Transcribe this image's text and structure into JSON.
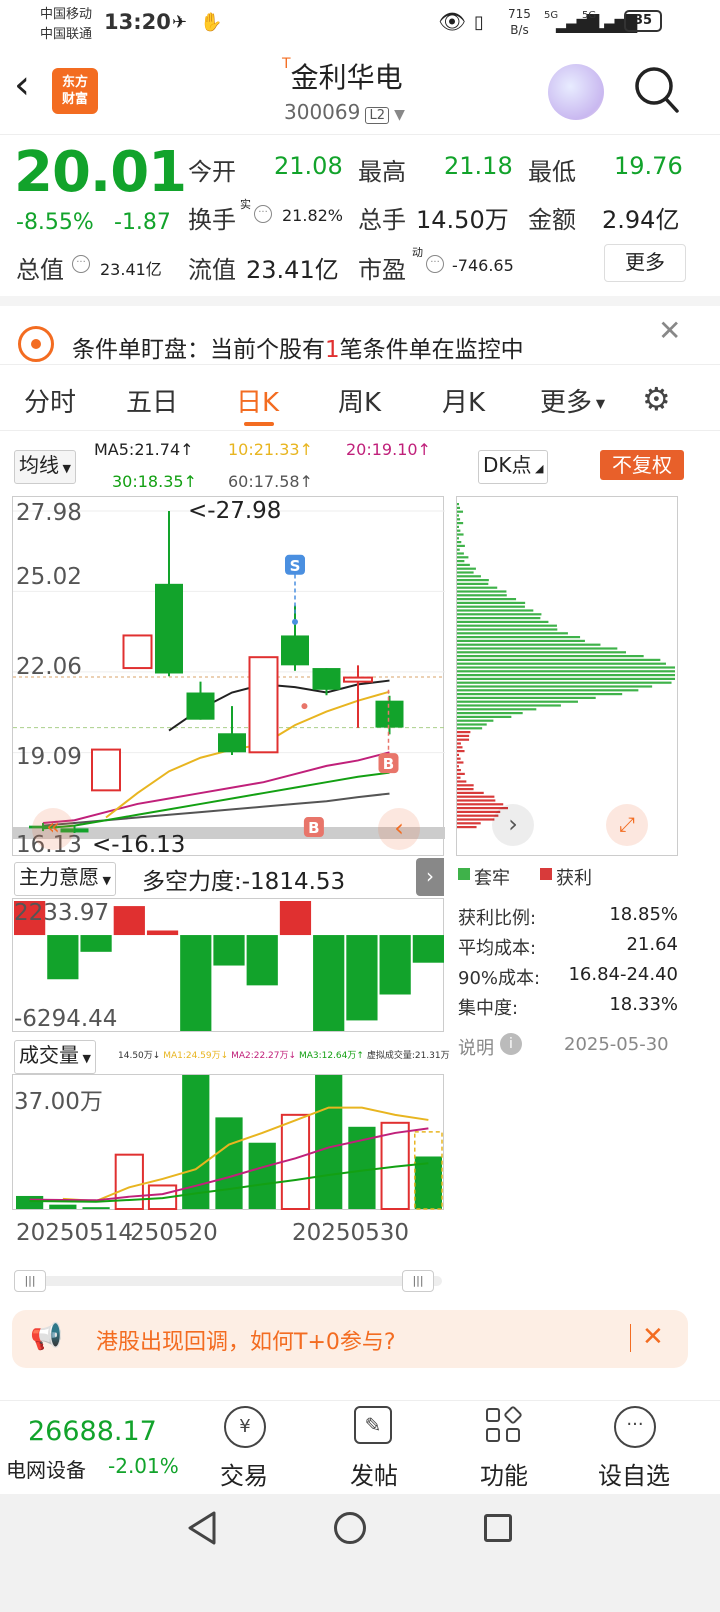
{
  "status_bar": {
    "carrier1": "中国移动",
    "carrier2": "中国联通",
    "time": "13:20",
    "speed_value": "715",
    "speed_unit": "B/s",
    "signal1": "5G",
    "signal2": "5G",
    "battery": "35"
  },
  "header": {
    "logo_line1": "东方",
    "logo_line2": "财富",
    "title_prefix": "T",
    "title": "金利华电",
    "code": "300069",
    "level": "L2"
  },
  "quote": {
    "price": "20.01",
    "change_pct": "-8.55%",
    "change": "-1.87",
    "open_label": "今开",
    "open": "21.08",
    "high_label": "最高",
    "high": "21.18",
    "low_label": "最低",
    "low": "19.76",
    "turnover_label": "换手",
    "turnover_sup": "实",
    "turnover": "21.82%",
    "volume_label": "总手",
    "volume": "14.50万",
    "amount_label": "金额",
    "amount": "2.94亿",
    "mktcap_label": "总值",
    "mktcap": "23.41亿",
    "float_label": "流值",
    "float": "23.41亿",
    "pe_label": "市盈",
    "pe_sup": "动",
    "pe": "-746.65",
    "more_button": "更多"
  },
  "banner": {
    "prefix": "条件单盯盘：当前个股有",
    "count": "1",
    "suffix": "笔条件单在监控中"
  },
  "tabs": [
    "分时",
    "五日",
    "日K",
    "周K",
    "月K",
    "更多"
  ],
  "active_tab": 2,
  "chart_controls": {
    "ma_select": "均线",
    "dk_select": "DK点",
    "no_adjust": "不复权",
    "ma5": "MA5:21.74↑",
    "ma10": "10:21.33↑",
    "ma20": "20:19.10↑",
    "ma30": "30:18.35↑",
    "ma60": "60:17.58↑"
  },
  "colors": {
    "up": "#e03030",
    "down": "#12a32b",
    "accent": "#f36c21",
    "ma5": "#222222",
    "ma10": "#e8b520",
    "ma20": "#c0207a",
    "ma30": "#13a013",
    "ma60": "#555555"
  },
  "chart_data": [
    {
      "type": "candlestick",
      "title": "日K",
      "y_ticks": [
        "27.98",
        "25.02",
        "22.06",
        "19.09",
        "16.13"
      ],
      "ylim": [
        16.13,
        27.98
      ],
      "annotations": [
        "<-27.98",
        "<-16.13"
      ],
      "markers": [
        "S",
        "B",
        "B"
      ],
      "candles": [
        {
          "open": 16.4,
          "close": 16.3,
          "high": 16.5,
          "low": 16.2,
          "dir": "down"
        },
        {
          "open": 16.3,
          "close": 16.15,
          "high": 16.4,
          "low": 16.13,
          "dir": "down"
        },
        {
          "open": 17.7,
          "close": 19.2,
          "high": 19.2,
          "low": 17.7,
          "dir": "up"
        },
        {
          "open": 22.2,
          "close": 23.4,
          "high": 23.4,
          "low": 22.2,
          "dir": "up"
        },
        {
          "open": 25.3,
          "close": 22.0,
          "high": 27.98,
          "low": 21.9,
          "dir": "down"
        },
        {
          "open": 21.3,
          "close": 20.3,
          "high": 21.7,
          "low": 20.3,
          "dir": "down"
        },
        {
          "open": 19.8,
          "close": 19.1,
          "high": 20.8,
          "low": 19.0,
          "dir": "down"
        },
        {
          "open": 19.1,
          "close": 22.6,
          "high": 22.6,
          "low": 19.1,
          "dir": "up"
        },
        {
          "open": 23.4,
          "close": 22.3,
          "high": 24.5,
          "low": 22.1,
          "dir": "down"
        },
        {
          "open": 22.2,
          "close": 21.4,
          "high": 22.2,
          "low": 21.2,
          "dir": "down"
        },
        {
          "open": 21.85,
          "close": 21.7,
          "high": 22.3,
          "low": 20.0,
          "dir": "up"
        },
        {
          "open": 21.0,
          "close": 20.01,
          "high": 21.18,
          "low": 19.76,
          "dir": "down"
        }
      ],
      "ma_lines": {
        "ma5": [
          null,
          null,
          null,
          null,
          19.9,
          20.7,
          21.3,
          21.6,
          21.5,
          21.3,
          21.6,
          21.74
        ],
        "ma10": [
          null,
          null,
          16.7,
          17.6,
          18.4,
          18.9,
          19.2,
          19.4,
          20.1,
          20.6,
          21.0,
          21.33
        ],
        "ma20": [
          16.5,
          16.6,
          16.9,
          17.2,
          17.4,
          17.6,
          17.8,
          18.0,
          18.3,
          18.6,
          18.8,
          19.1
        ],
        "ma30": [
          16.3,
          16.4,
          16.6,
          16.8,
          17.0,
          17.2,
          17.4,
          17.6,
          17.8,
          18.0,
          18.2,
          18.35
        ],
        "ma60": [
          16.4,
          16.5,
          16.6,
          16.7,
          16.8,
          16.9,
          17.0,
          17.1,
          17.2,
          17.3,
          17.45,
          17.58
        ]
      }
    },
    {
      "type": "bar",
      "title": "主力意愿",
      "subtitle": "多空力度:-1814.53",
      "y_ticks": [
        "2233.97",
        "-6294.44"
      ],
      "ylim": [
        -6294.44,
        2233.97
      ],
      "values": [
        2233.97,
        -2900,
        -1100,
        1900,
        300,
        -6294.44,
        -2000,
        -3300,
        2233.97,
        -6294.44,
        -5600,
        -3900,
        -1814.53
      ]
    },
    {
      "type": "bar",
      "title": "成交量",
      "legend": [
        "14.50万↓",
        "MA1:24.59万↓",
        "MA2:22.27万↓",
        "MA3:12.64万↑",
        "虚拟成交量:21.31万"
      ],
      "y_ticks": [
        "37.00万"
      ],
      "x_ticks": [
        "20250514",
        "250520",
        "20250530"
      ],
      "values": [
        3.6,
        1.2,
        0.5,
        15.0,
        6.5,
        37.0,
        25.3,
        18.3,
        26.0,
        37.0,
        22.7,
        23.8,
        14.5
      ],
      "dirs": [
        "down",
        "down",
        "down",
        "up",
        "up",
        "down",
        "down",
        "down",
        "up",
        "down",
        "down",
        "up",
        "down"
      ]
    },
    {
      "type": "bar",
      "title": "筹码分布",
      "legend": [
        "套牢",
        "获利"
      ],
      "orientation": "horizontal"
    }
  ],
  "chip_info": {
    "rows": [
      {
        "label": "获利比例:",
        "value": "18.85%"
      },
      {
        "label": "平均成本:",
        "value": "21.64"
      },
      {
        "label": "90%成本:",
        "value": "16.84-24.40"
      },
      {
        "label": "集中度:",
        "value": "18.33%"
      }
    ],
    "note_label": "说明",
    "date": "2025-05-30"
  },
  "ad": {
    "text": "港股出现回调，如何T+0参与?"
  },
  "bottom": {
    "index_value": "26688.17",
    "index_name": "电网设备",
    "index_change": "-2.01%",
    "buttons": [
      "交易",
      "发帖",
      "功能",
      "设自选"
    ]
  }
}
